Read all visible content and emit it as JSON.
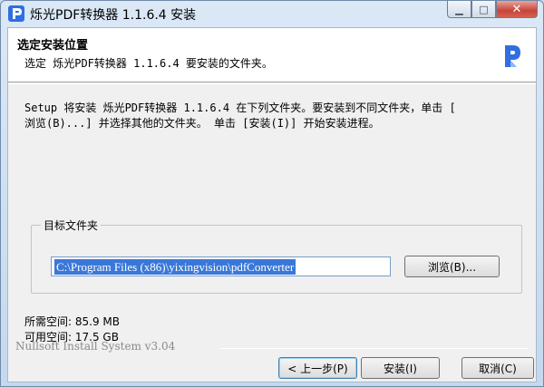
{
  "window": {
    "title": "烁光PDF转换器 1.1.6.4 安装",
    "min_glyph": "▁",
    "max_glyph": "□",
    "close_glyph": "✕"
  },
  "header": {
    "title": "选定安装位置",
    "subtitle": "选定 烁光PDF转换器 1.1.6.4 要安装的文件夹。",
    "logo_color": "#2f6fe0"
  },
  "intro": {
    "line1": "Setup 将安装 烁光PDF转换器 1.1.6.4 在下列文件夹。要安装到不同文件夹，单击 [",
    "line2": "浏览(B)...] 并选择其他的文件夹。 单击 [安装(I)] 开始安装进程。"
  },
  "destination": {
    "group_label": "目标文件夹",
    "path": "C:\\Program Files (x86)\\yixingvision\\pdfConverter",
    "browse_label": "浏览(B)..."
  },
  "space": {
    "required": "所需空间: 85.9 MB",
    "available": "可用空间: 17.5 GB"
  },
  "branding": "Nullsoft Install System v3.04",
  "buttons": {
    "back": "< 上一步(P)",
    "install": "安装(I)",
    "cancel": "取消(C)"
  },
  "colors": {
    "selection": "#3a78d8",
    "close_button": "#c7443a"
  }
}
